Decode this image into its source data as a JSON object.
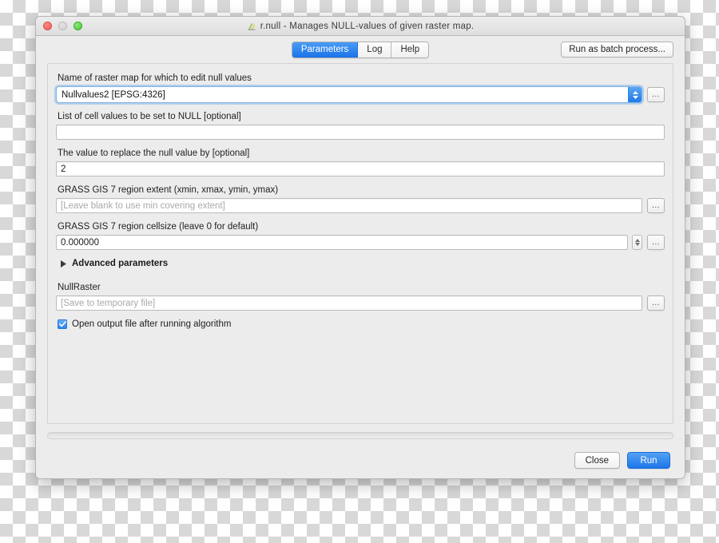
{
  "window": {
    "title": "r.null - Manages NULL-values of given raster map.",
    "title_icon": "grass-algorithm-icon",
    "traffic_lights": {
      "close": "close-window-button",
      "minimize": "minimize-window-button",
      "maximize": "maximize-window-button"
    }
  },
  "toolbar": {
    "tabs": [
      {
        "label": "Parameters",
        "active": true
      },
      {
        "label": "Log",
        "active": false
      },
      {
        "label": "Help",
        "active": false
      }
    ],
    "batch_button": "Run as batch process..."
  },
  "fields": {
    "raster_map": {
      "label": "Name of raster map for which to edit null values",
      "value": "Nullvalues2 [EPSG:4326]",
      "dots": "...",
      "arrow_icon": "chevron-updown-icon"
    },
    "cell_values": {
      "label": "List of cell values to be set to NULL [optional]",
      "value": "",
      "placeholder": ""
    },
    "replace_value": {
      "label": "The value to replace the null value by [optional]",
      "value": "2"
    },
    "region_extent": {
      "label": "GRASS GIS 7 region extent (xmin, xmax, ymin, ymax)",
      "value": "",
      "placeholder": "[Leave blank to use min covering extent]",
      "dots": "..."
    },
    "region_cellsize": {
      "label": "GRASS GIS 7 region cellsize (leave 0 for default)",
      "value": "0.000000",
      "dots": "...",
      "stepper_icon": "spinner-updown-icon"
    },
    "advanced": {
      "label": "Advanced parameters",
      "expanded": false,
      "disclosure_icon": "triangle-right-icon"
    },
    "null_raster": {
      "label": "NullRaster",
      "value": "",
      "placeholder": "[Save to temporary file]",
      "dots": "..."
    },
    "open_output": {
      "label": "Open output file after running algorithm",
      "checked": true,
      "check_icon": "checkmark-icon"
    }
  },
  "footer": {
    "progress_value": 0,
    "close_label": "Close",
    "run_label": "Run"
  },
  "colors": {
    "accent_blue": "#1d76e9",
    "window_bg": "#ececec",
    "field_bg": "#ffffff",
    "placeholder_text": "#a9a9a9"
  }
}
